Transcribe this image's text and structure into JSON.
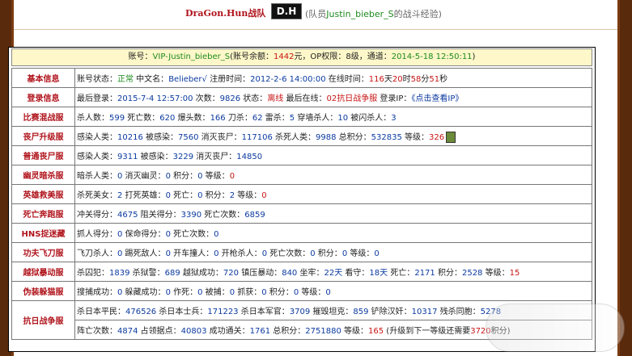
{
  "header": {
    "team": "DraGon.Hun战队",
    "logo_text": "D.H",
    "subtitle_pre": "(队员",
    "subtitle_name": "Justin_bieber_S",
    "subtitle_post": "的战斗经验)"
  },
  "account": {
    "l1": "账号：",
    "account": "VIP-Justin_bieber_S",
    "l2": "(账号余额：",
    "balance": "1442",
    "l3": "元，OP权限：8级，通道：",
    "date": "2014-5-18 12:50:11",
    "l4": ")"
  },
  "rows": {
    "basic": {
      "cat": "基本信息",
      "a1": "账号状态：",
      "status": "正常",
      "a2": " 中文名：",
      "cname": "Belieber√",
      "a3": " 注册时间：",
      "reg": "2012-2-6 14:00:00",
      "a4": " 在线时间：",
      "t1": "116",
      "a5": "天",
      "t2": "20",
      "a6": "时",
      "t3": "58",
      "a7": "分",
      "t4": "51",
      "a8": "秒"
    },
    "login": {
      "cat": "登录信息",
      "a1": "最后登录：",
      "last": "2015-7-4 12:57:00",
      "a2": " 次数：",
      "times": "9826",
      "a3": " 状态：",
      "state": "离线",
      "a4": " 最后在线：",
      "server": "02抗日战争服",
      "a5": " 登录IP：",
      "ip": "《点击查看IP》"
    },
    "match": {
      "cat": "比赛混战服",
      "a1": "杀人数：",
      "v1": "599",
      "a2": " 死亡数：",
      "v2": "620",
      "a3": " 爆头数：",
      "v3": "166",
      "a4": " 刀杀：",
      "v4": "62",
      "a5": " 雷杀：",
      "v5": "5",
      "a6": " 穿墙杀人：",
      "v6": "10",
      "a7": " 被闪杀人：",
      "v7": "3"
    },
    "zombie_up": {
      "cat": "丧尸升级服",
      "a1": "感染人类：",
      "v1": "10216",
      "a2": " 被感染：",
      "v2": "7560",
      "a3": " 消灭丧尸：",
      "v3": "117106",
      "a4": " 杀死人类：",
      "v4": "9988",
      "a5": " 总积分：",
      "v5": "532835",
      "a6": " 等级：",
      "v6": "326"
    },
    "zombie": {
      "cat": "普通丧尸服",
      "a1": "感染人类：",
      "v1": "9311",
      "a2": " 被感染：",
      "v2": "3229",
      "a3": " 消灭丧尸：",
      "v3": "14850"
    },
    "ghost": {
      "cat": "幽灵暗杀服",
      "a1": "暗杀人类：",
      "v1": "0",
      "a2": " 消灭幽灵：",
      "v2": "0",
      "a3": " 积分：",
      "v3": "0",
      "a4": " 等级：",
      "v4": "0"
    },
    "hero": {
      "cat": "英雄救美服",
      "a1": "杀死美女：",
      "v1": "2",
      "a2": " 打死英雄：",
      "v2": "0",
      "a3": " 死亡：",
      "v3": "0",
      "a4": " 积分：",
      "v4": "2",
      "a5": " 等级：",
      "v5": "0"
    },
    "death": {
      "cat": "死亡奔跑服",
      "a1": "冲关得分：",
      "v1": "4675",
      "a2": " 阻关得分：",
      "v2": "3390",
      "a3": " 死亡次数：",
      "v3": "6859"
    },
    "hns": {
      "cat": "HNS捉迷藏",
      "a1": "抓人得分：",
      "v1": "0",
      "a2": " 保命得分：",
      "v2": "0",
      "a3": " 死亡次数：",
      "v3": "0"
    },
    "kungfu": {
      "cat": "功夫飞刀服",
      "a1": "飞刀杀人：",
      "v1": "0",
      "a2": " 踢死敌人：",
      "v2": "0",
      "a3": " 开车撞人：",
      "v3": "0",
      "a4": " 开枪杀人：",
      "v4": "0",
      "a5": " 死亡次数：",
      "v5": "0",
      "a6": " 积分：",
      "v6": "0",
      "a7": " 等级：",
      "v7": "0"
    },
    "jail": {
      "cat": "越狱暴动服",
      "a1": "杀囚犯：",
      "v1": "1839",
      "a2": " 杀狱警：",
      "v2": "689",
      "a3": " 越狱成功：",
      "v3": "720",
      "a4": " 镇压暴动：",
      "v4": "840",
      "a5": " 坐牢：",
      "v5": "22天",
      "a6": " 看守：",
      "v6": "18天",
      "a7": " 死亡：",
      "v7": "2171",
      "a8": " 积分：",
      "v8": "2528",
      "a9": " 等级：",
      "v9": "15"
    },
    "disguise": {
      "cat": "伪装躲猫服",
      "a1": "搜捕成功：",
      "v1": "0",
      "a2": " 躲藏成功：",
      "v2": "0",
      "a3": " 作死：",
      "v3": "0",
      "a4": " 被捕：",
      "v4": "0",
      "a5": " 抓获：",
      "v5": "0",
      "a6": " 积分：",
      "v6": "0",
      "a7": " 等级：",
      "v7": "0"
    },
    "war": {
      "cat": "抗日战争服",
      "a1": "杀日本平民：",
      "v1": "476526",
      "a2": " 杀日本士兵：",
      "v2": "171223",
      "a3": " 杀日本军官：",
      "v3": "3709",
      "a4": " 摧毁坦克：",
      "v4": "859",
      "a5": " 铲除汉奸：",
      "v5": "10317",
      "a6": " 残杀同胞：",
      "v6": "5278",
      "b1": "阵亡次数：",
      "w1": "4874",
      "b2": " 占领据点：",
      "w2": "40803",
      "b3": " 成功通关：",
      "w3": "1761",
      "b4": " 总积分：",
      "w4": "2751880",
      "b5": " 等级：",
      "w5": "165",
      "b6": " (升级到下一等级还需要",
      "w6": "3720",
      "b7": "积分)"
    }
  }
}
